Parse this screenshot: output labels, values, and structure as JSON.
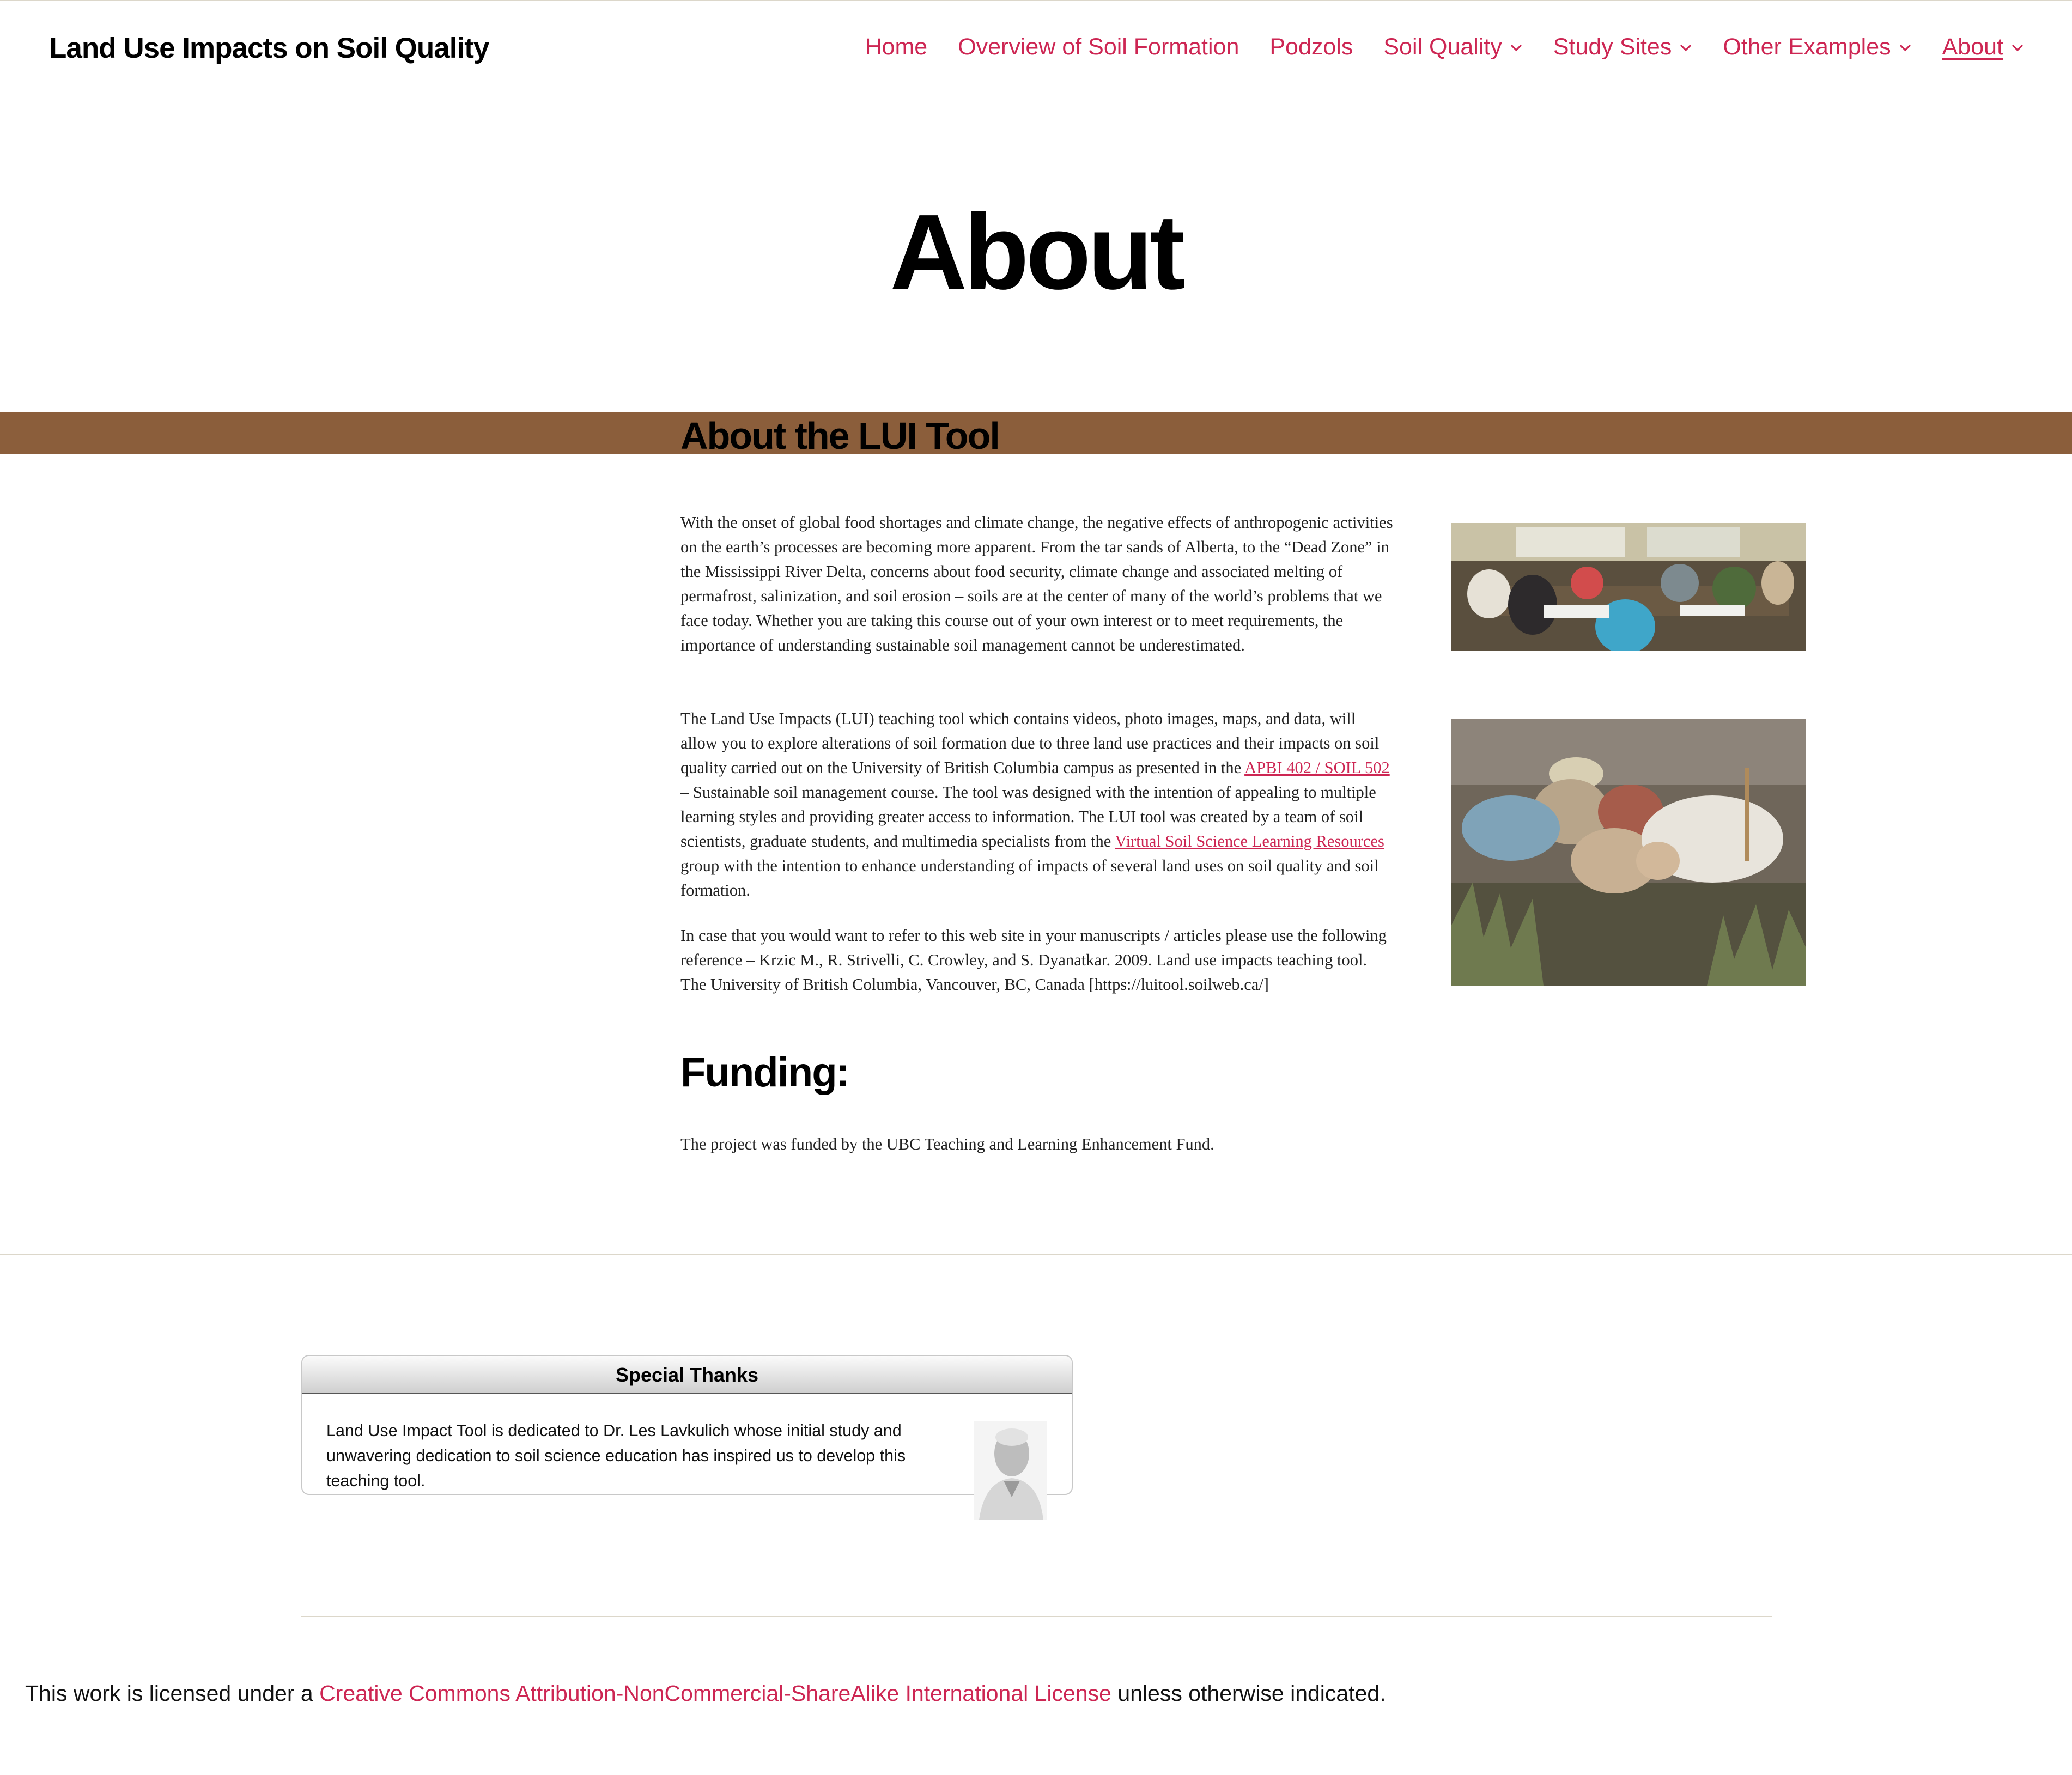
{
  "header": {
    "site_title": "Land Use Impacts on Soil Quality",
    "nav": [
      {
        "label": "Home",
        "dropdown": false
      },
      {
        "label": "Overview of Soil Formation",
        "dropdown": false
      },
      {
        "label": "Podzols",
        "dropdown": false
      },
      {
        "label": "Soil Quality",
        "dropdown": true
      },
      {
        "label": "Study Sites",
        "dropdown": true
      },
      {
        "label": "Other Examples",
        "dropdown": true
      },
      {
        "label": "About",
        "dropdown": true,
        "current": true
      }
    ]
  },
  "page": {
    "title": "About",
    "section_heading": "About the LUI Tool",
    "para1": "With the onset of global food shortages and climate change, the negative effects of anthropogenic activities on the earth’s processes are becoming more apparent. From the tar sands of Alberta, to the “Dead Zone” in the Mississippi River Delta, concerns about food security, climate change and associated melting of permafrost, salinization, and soil erosion – soils are at the center of many of the world’s problems that we face today. Whether you are taking this course out of your own interest or to meet requirements, the importance of understanding sustainable soil management cannot be underestimated.",
    "para2": {
      "part1": "The Land Use Impacts (LUI) teaching tool which contains videos, photo images, maps, and data, will allow you to explore alterations of soil formation due to three land use practices and their impacts on soil quality carried out on the University of British Columbia campus as presented in the ",
      "link1": "APBI 402 / SOIL 502",
      "part2": " – Sustainable soil management course. The tool was designed with the intention of appealing to multiple learning styles and providing greater access to information. The LUI tool was created by a team of soil scientists, graduate students, and multimedia specialists from the ",
      "link2": "Virtual Soil Science Learning Resources",
      "part3": " group with the intention to enhance understanding of impacts of several land uses on soil quality and soil formation."
    },
    "para3": "In case that you would want to refer to this web site in your manuscripts / articles please use the following reference – Krzic M., R. Strivelli, C. Crowley, and S. Dyanatkar. 2009. Land use impacts teaching tool. The University of British Columbia, Vancouver, BC, Canada [https://luitool.soilweb.ca/]",
    "funding_heading": "Funding:",
    "funding_text": "The project was funded by the UBC Teaching and Learning Enhancement Fund."
  },
  "thanks": {
    "title": "Special Thanks",
    "text": "Land Use Impact Tool is dedicated to Dr. Les Lavkulich whose initial study and unwavering dedication to soil science education has inspired us to develop this teaching tool."
  },
  "footer": {
    "prefix": "This work is licensed under a ",
    "link": "Creative Commons Attribution-NonCommercial-ShareAlike International License",
    "suffix": " unless otherwise indicated."
  },
  "colors": {
    "accent": "#cd2653",
    "band": "#8b5e3b"
  }
}
